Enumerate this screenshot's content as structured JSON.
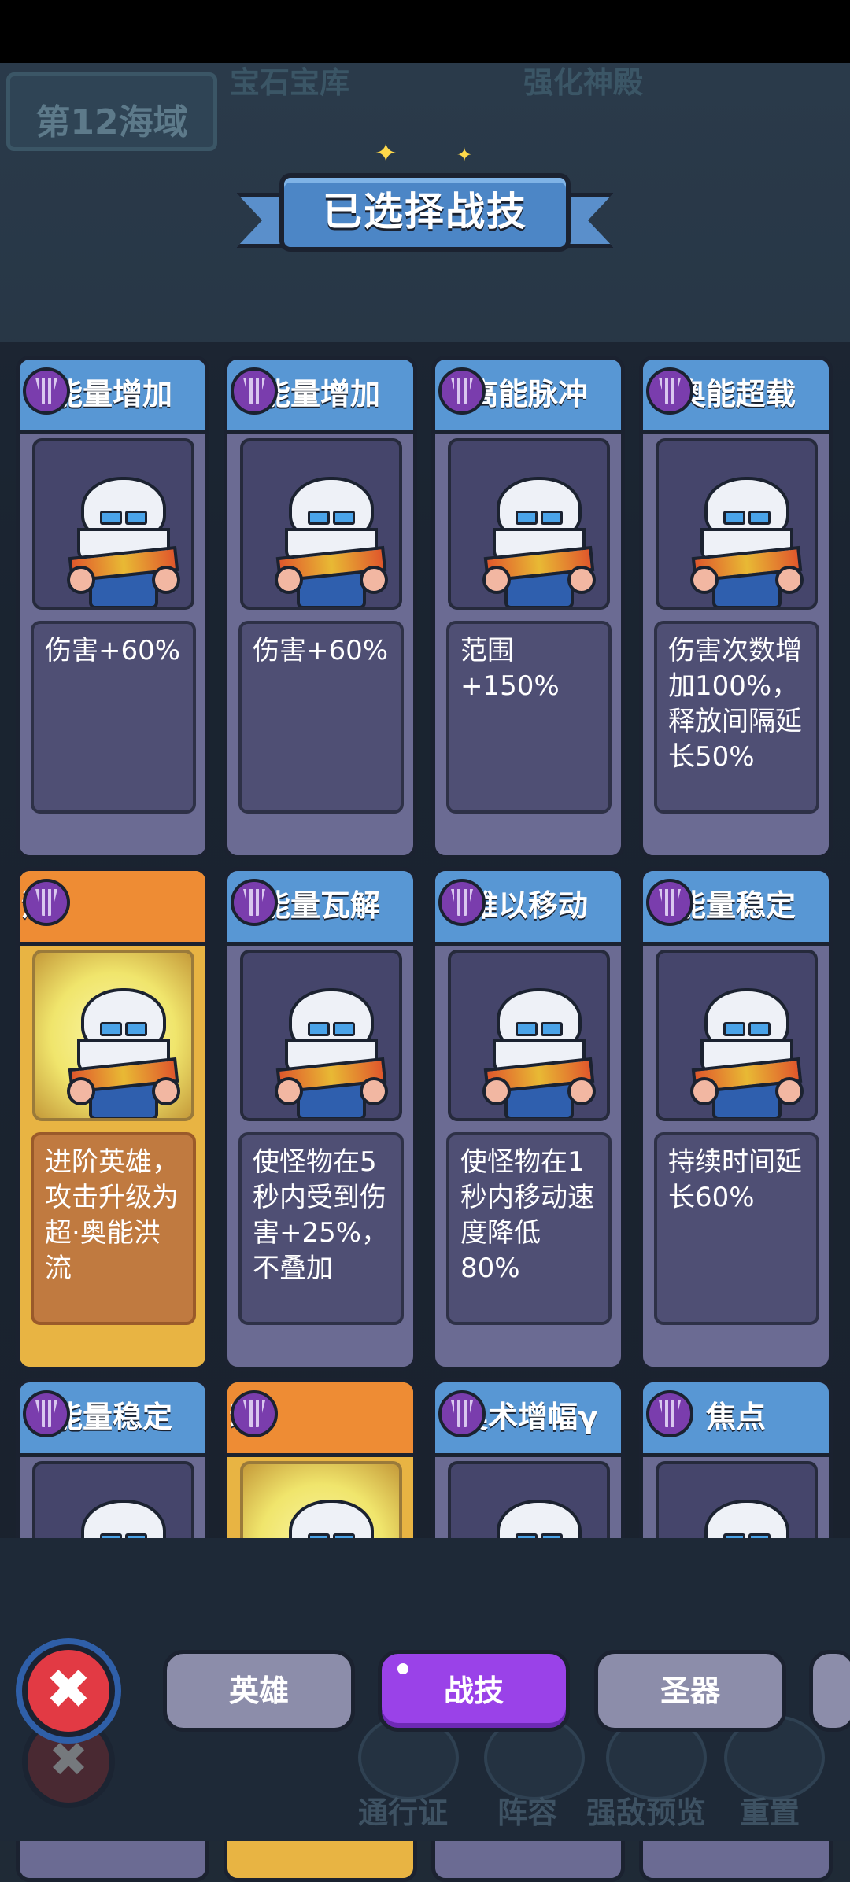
{
  "map": {
    "sea_label": "第12海域",
    "area_left": "宝石宝库",
    "area_right": "强化神殿"
  },
  "panel": {
    "title": "已选择战技"
  },
  "cards": [
    {
      "title": "能量增加",
      "desc": "伤害+60%",
      "style": "blue"
    },
    {
      "title": "能量增加",
      "desc": "伤害+60%",
      "style": "blue"
    },
    {
      "title": "高能脉冲",
      "desc": "范围+150%",
      "style": "blue"
    },
    {
      "title": "奥能超载",
      "desc": "伤害次数增加100%，释放间隔延长50%",
      "style": "blue"
    },
    {
      "title": "流",
      "desc": "进阶英雄，攻击升级为超·奥能洪流",
      "style": "gold"
    },
    {
      "title": "能量瓦解",
      "desc": "使怪物在5秒内受到伤害+25%，不叠加",
      "style": "blue"
    },
    {
      "title": "难以移动",
      "desc": "使怪物在1秒内移动速度降低80%",
      "style": "blue"
    },
    {
      "title": "能量稳定",
      "desc": "持续时间延长60%",
      "style": "blue"
    },
    {
      "title": "能量稳定",
      "desc": "",
      "style": "blue"
    },
    {
      "title": "动",
      "desc": "",
      "style": "gold"
    },
    {
      "title": "奥术增幅γ",
      "desc": "",
      "style": "blue"
    },
    {
      "title": "焦点",
      "desc": "",
      "style": "blue"
    }
  ],
  "tabs": {
    "hero": "英雄",
    "skill": "战技",
    "relic": "圣器",
    "active": "skill"
  },
  "bottom_nav": {
    "pass": "通行证",
    "lineup": "阵容",
    "preview": "强敌预览",
    "reset": "重置"
  },
  "close_symbol": "✖"
}
